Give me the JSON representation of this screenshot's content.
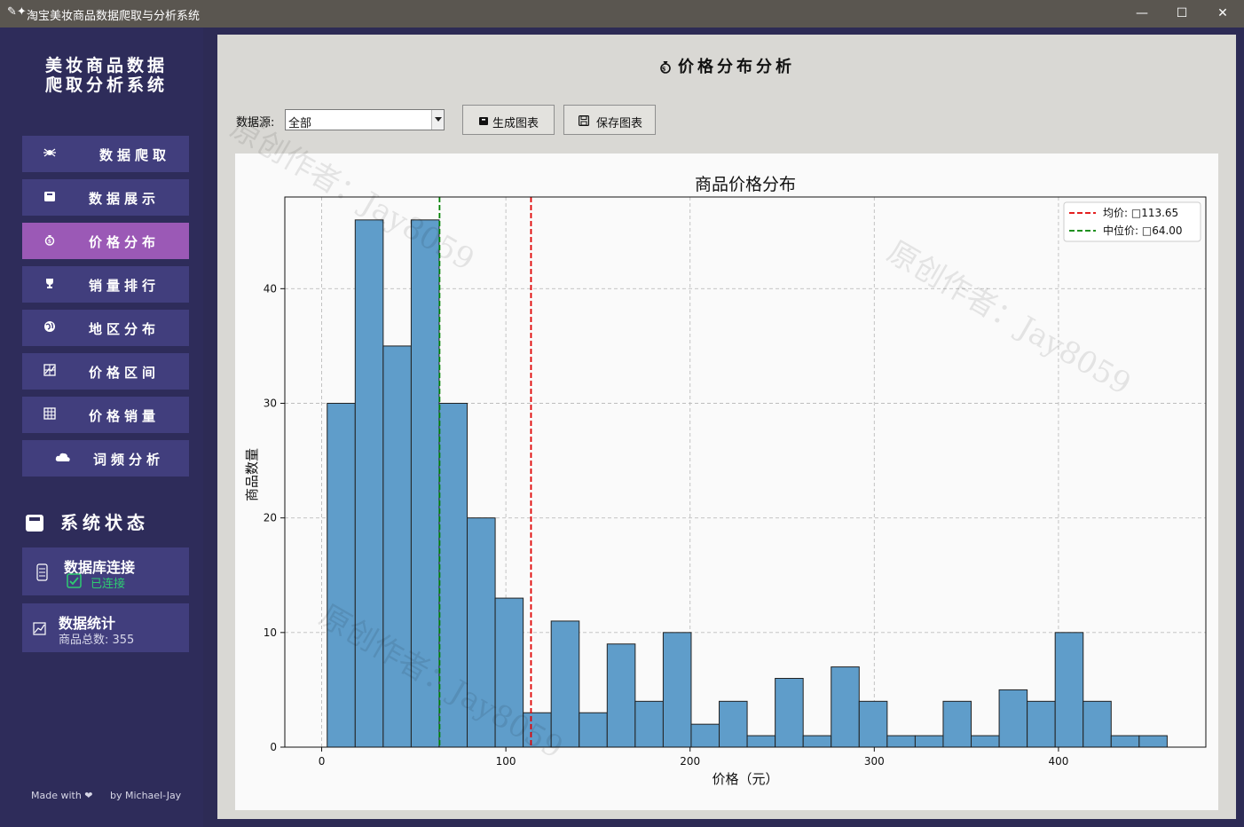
{
  "window": {
    "title": "淘宝美妆商品数据爬取与分析系统",
    "icon": "feather-sparkle-icon",
    "minimize": "—",
    "maximize": "☐",
    "close": "✕"
  },
  "sidebar": {
    "title": [
      "美妆商品数据",
      "爬取分析系统"
    ],
    "items": [
      {
        "label": "数据爬取",
        "icon": "spider-icon"
      },
      {
        "label": "数据展示",
        "icon": "box-icon"
      },
      {
        "label": "价格分布",
        "icon": "money-bag-icon",
        "active": true
      },
      {
        "label": "销量排行",
        "icon": "trophy-icon"
      },
      {
        "label": "地区分布",
        "icon": "globe-icon"
      },
      {
        "label": "价格区间",
        "icon": "chart-grid-icon"
      },
      {
        "label": "价格销量",
        "icon": "table-grid-icon"
      },
      {
        "label": "词频分析",
        "icon": "cloud-icon"
      }
    ],
    "status_title": "系统状态",
    "db_card": {
      "title": "数据库连接",
      "status": "已连接",
      "status_color": "#2ecc71"
    },
    "stats_card": {
      "title": "数据统计",
      "count_label": "商品总数: 355"
    },
    "footer": {
      "made_with": "Made with ❤",
      "by": "by Michael-Jay"
    }
  },
  "main": {
    "page_title": "价格分布分析",
    "datasource_label": "数据源:",
    "datasource_value": "全部",
    "generate_button": "生成图表",
    "save_button": "保存图表",
    "watermark": "原创作者：Jay8059"
  },
  "chart_data": {
    "type": "bar",
    "title": "商品价格分布",
    "xlabel": "价格（元）",
    "ylabel": "商品数量",
    "bin_start": 3,
    "bin_width": 15.2,
    "values": [
      30,
      46,
      35,
      46,
      30,
      20,
      13,
      3,
      11,
      3,
      9,
      4,
      10,
      2,
      4,
      1,
      6,
      1,
      7,
      4,
      1,
      1,
      4,
      1,
      5,
      4,
      10,
      4,
      1,
      1
    ],
    "xlim": [
      -20,
      480
    ],
    "ylim": [
      0,
      48
    ],
    "xticks": [
      0,
      100,
      200,
      300,
      400
    ],
    "yticks": [
      0,
      10,
      20,
      30,
      40
    ],
    "grid": true,
    "legend_placement": "top-right",
    "bar_color": "#5f9dca",
    "lines": [
      {
        "label": "均价: □113.65",
        "value": 113.65,
        "color": "#e00000"
      },
      {
        "label": "中位价: □64.00",
        "value": 64.0,
        "color": "#008000"
      }
    ]
  }
}
